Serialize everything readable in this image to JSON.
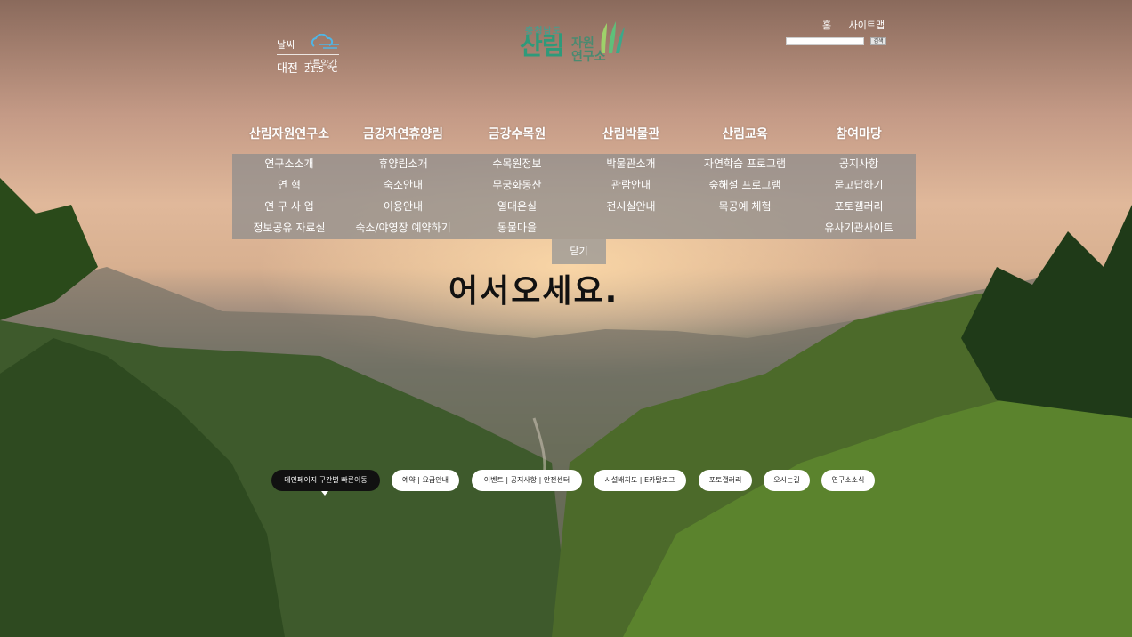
{
  "weather": {
    "label": "날씨",
    "icon": "cloud-wind-icon",
    "city": "대전",
    "condition": "구름약간",
    "temperature": "21.5 °C"
  },
  "logo": {
    "region": "충청남도",
    "main": "산림",
    "sub1": "자원",
    "sub2": "연구소"
  },
  "top_links": {
    "home": "홈",
    "sitemap": "사이트맵",
    "search_button": "검색"
  },
  "nav": [
    {
      "label": "산림자원연구소",
      "items": [
        "연구소소개",
        "연 혁",
        "연 구 사 업",
        "정보공유 자료실"
      ]
    },
    {
      "label": "금강자연휴양림",
      "items": [
        "휴양림소개",
        "숙소안내",
        "이용안내",
        "숙소/야영장 예약하기"
      ]
    },
    {
      "label": "금강수목원",
      "items": [
        "수목원정보",
        "무궁화동산",
        "열대온실",
        "동물마을"
      ]
    },
    {
      "label": "산림박물관",
      "items": [
        "박물관소개",
        "관람안내",
        "전시실안내"
      ]
    },
    {
      "label": "산림교육",
      "items": [
        "자연학습 프로그램",
        "숲해설 프로그램",
        "목공예 체험"
      ]
    },
    {
      "label": "참여마당",
      "items": [
        "공지사항",
        "묻고답하기",
        "포토갤러리",
        "유사기관사이트"
      ]
    }
  ],
  "close_label": "닫기",
  "welcome": "어서오세요.",
  "quick_links": [
    "메인페이지 구간별 빠른이동",
    "예약 | 요금안내",
    "이벤트 | 공지사항 | 안전센터",
    "시설배치도 | E카탈로그",
    "포토갤러리",
    "오시는길",
    "연구소소식"
  ],
  "colors": {
    "logo_green": "#2f9a7a",
    "submenu_bg": "#8c8c8c",
    "quick_active": "#111111"
  }
}
